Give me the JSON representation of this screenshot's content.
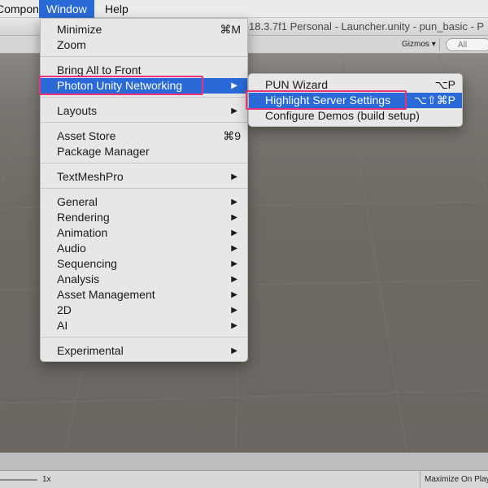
{
  "menubar": {
    "items": [
      "Component",
      "Window",
      "Help"
    ]
  },
  "titlebar": {
    "text": "18.3.7f1 Personal - Launcher.unity - pun_basic - P"
  },
  "scene_toolbar": {
    "gizmos_label": "Gizmos",
    "dropdown_glyph": "▾",
    "search_placeholder": "All"
  },
  "window_menu": {
    "items": [
      {
        "label": "Minimize",
        "shortcut": "⌘M"
      },
      {
        "label": "Zoom"
      },
      {
        "label": "Bring All to Front"
      },
      {
        "label": "Photon Unity Networking",
        "submenu": true,
        "highlighted": true
      },
      {
        "label": "Layouts",
        "submenu": true
      },
      {
        "label": "Asset Store",
        "shortcut": "⌘9"
      },
      {
        "label": "Package Manager"
      },
      {
        "label": "TextMeshPro",
        "submenu": true
      },
      {
        "label": "General",
        "submenu": true
      },
      {
        "label": "Rendering",
        "submenu": true
      },
      {
        "label": "Animation",
        "submenu": true
      },
      {
        "label": "Audio",
        "submenu": true
      },
      {
        "label": "Sequencing",
        "submenu": true
      },
      {
        "label": "Analysis",
        "submenu": true
      },
      {
        "label": "Asset Management",
        "submenu": true
      },
      {
        "label": "2D",
        "submenu": true
      },
      {
        "label": "AI",
        "submenu": true
      },
      {
        "label": "Experimental",
        "submenu": true
      }
    ],
    "submenu_arrow": "▶"
  },
  "photon_submenu": {
    "items": [
      {
        "label": "PUN Wizard",
        "shortcut": "⌥P"
      },
      {
        "label": "Highlight Server Settings",
        "shortcut": "⌥⇧⌘P",
        "highlighted": true
      },
      {
        "label": "Configure Demos (build setup)"
      }
    ]
  },
  "statusbar": {
    "scale_label": "1x",
    "maximize_label": "Maximize On Play"
  },
  "colors": {
    "highlight": "#2a6ad8",
    "annotation": "#e8337a",
    "scene_bg": "#6e6963"
  }
}
